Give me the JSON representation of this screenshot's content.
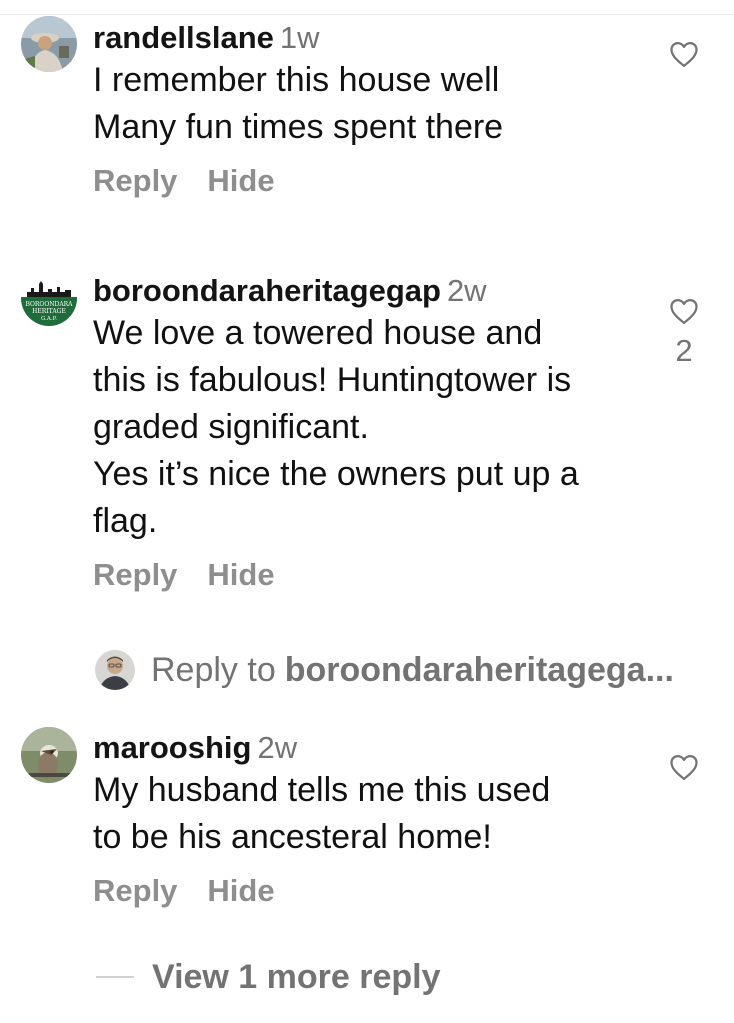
{
  "comments": [
    {
      "username": "randellslane",
      "time": "1w",
      "lines": [
        "I remember this house well",
        "Many fun times spent there"
      ],
      "reply_label": "Reply",
      "hide_label": "Hide",
      "like_count": ""
    },
    {
      "username": "boroondaraheritagegap",
      "time": "2w",
      "lines": [
        "We love a towered house and",
        "this is fabulous! Huntingtower is",
        "graded significant.",
        "Yes it’s nice the owners put up a",
        "flag."
      ],
      "reply_label": "Reply",
      "hide_label": "Hide",
      "like_count": "2",
      "avatar_text": [
        "BOROONDARA",
        "HERITAGE",
        "G.A.P."
      ]
    },
    {
      "username": "marooshig",
      "time": "2w",
      "lines": [
        "My husband tells me this used",
        "to be his ancesteral home!"
      ],
      "reply_label": "Reply",
      "hide_label": "Hide",
      "like_count": ""
    }
  ],
  "reply_to": {
    "label": "Reply to",
    "target": "boroondaraheritagega..."
  },
  "view_more": {
    "label": "View 1 more reply"
  },
  "icons": {
    "like": "heart-outline-icon"
  },
  "colors": {
    "text": "#111111",
    "muted": "#737373",
    "actions": "#8e8e8e",
    "heritage_green": "#1f6b3a"
  }
}
